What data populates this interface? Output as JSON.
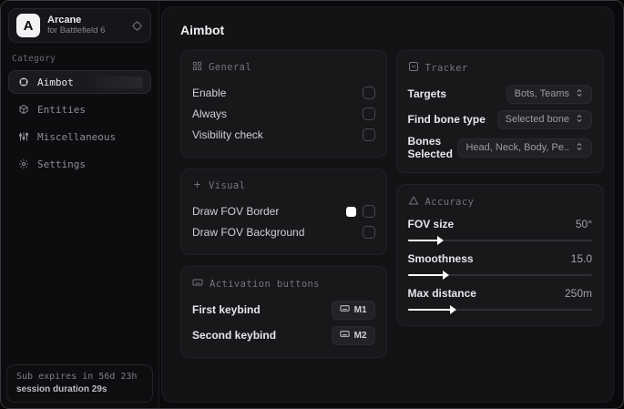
{
  "app": {
    "logo_letter": "A",
    "name": "Arcane",
    "subtitle": "for Battlefield 6"
  },
  "colors": {
    "swatch_fov_border": "#ffffff",
    "slider_fill": "#ffffff"
  },
  "sidebar": {
    "category_label": "Category",
    "items": [
      {
        "label": "Aimbot",
        "active": true
      },
      {
        "label": "Entities",
        "active": false
      },
      {
        "label": "Miscellaneous",
        "active": false
      },
      {
        "label": "Settings",
        "active": false
      }
    ],
    "footer": {
      "expiry": "Sub expires in 56d 23h",
      "session": "session duration 29s"
    }
  },
  "main": {
    "title": "Aimbot",
    "general": {
      "title": "General",
      "rows": [
        {
          "label": "Enable",
          "checked": false
        },
        {
          "label": "Always",
          "checked": false
        },
        {
          "label": "Visibility check",
          "checked": false
        }
      ]
    },
    "visual": {
      "title": "Visual",
      "rows": [
        {
          "label": "Draw FOV Border",
          "swatch": "#ffffff",
          "checked": false
        },
        {
          "label": "Draw FOV Background",
          "checked": false
        }
      ]
    },
    "activation": {
      "title": "Activation buttons",
      "rows": [
        {
          "label": "First keybind",
          "key": "M1"
        },
        {
          "label": "Second keybind",
          "key": "M2"
        }
      ]
    },
    "tracker": {
      "title": "Tracker",
      "rows": [
        {
          "label": "Targets",
          "value": "Bots, Teams"
        },
        {
          "label": "Find bone type",
          "value": "Selected bone"
        },
        {
          "label": "Bones Selected",
          "value": "Head, Neck, Body, Pe.."
        }
      ]
    },
    "accuracy": {
      "title": "Accuracy",
      "rows": [
        {
          "label": "FOV size",
          "value": "50°",
          "percent": 17
        },
        {
          "label": "Smoothness",
          "value": "15.0",
          "percent": 20
        },
        {
          "label": "Max distance",
          "value": "250m",
          "percent": 24
        }
      ]
    }
  }
}
